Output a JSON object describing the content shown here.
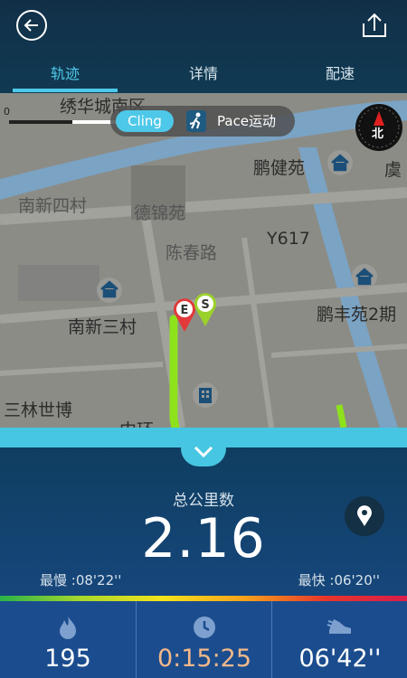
{
  "tabs": [
    {
      "label": "轨迹"
    },
    {
      "label": "详情"
    },
    {
      "label": "配速"
    }
  ],
  "map": {
    "labels": [
      "绣华城南区",
      "鹏健苑",
      "虞",
      "南新四村",
      "德锦苑",
      "陈春路",
      "Y617",
      "南新三村",
      "鹏丰苑2期",
      "三林世博",
      "中环"
    ],
    "scale": "0",
    "markers": {
      "start": "S",
      "end": "E"
    },
    "compass": "北",
    "route_color": "#8ee21c"
  },
  "badge": {
    "cling": "Cling",
    "pace": "Pace运动"
  },
  "summary": {
    "distance_label": "总公里数",
    "distance_value": "2.16",
    "slowest": "最慢 :08'22''",
    "fastest": "最快 :06'20''"
  },
  "stats": [
    {
      "icon": "flame-icon",
      "value": "195",
      "color": "#ffffff"
    },
    {
      "icon": "clock-icon",
      "value": "0:15:25",
      "color": "#f3b88a"
    },
    {
      "icon": "shoe-icon",
      "value": "06'42''",
      "color": "#ffffff"
    }
  ],
  "colors": {
    "accent": "#4ec8e8",
    "header_bg": "#113048",
    "stats_bg": "#1b4d8e"
  }
}
